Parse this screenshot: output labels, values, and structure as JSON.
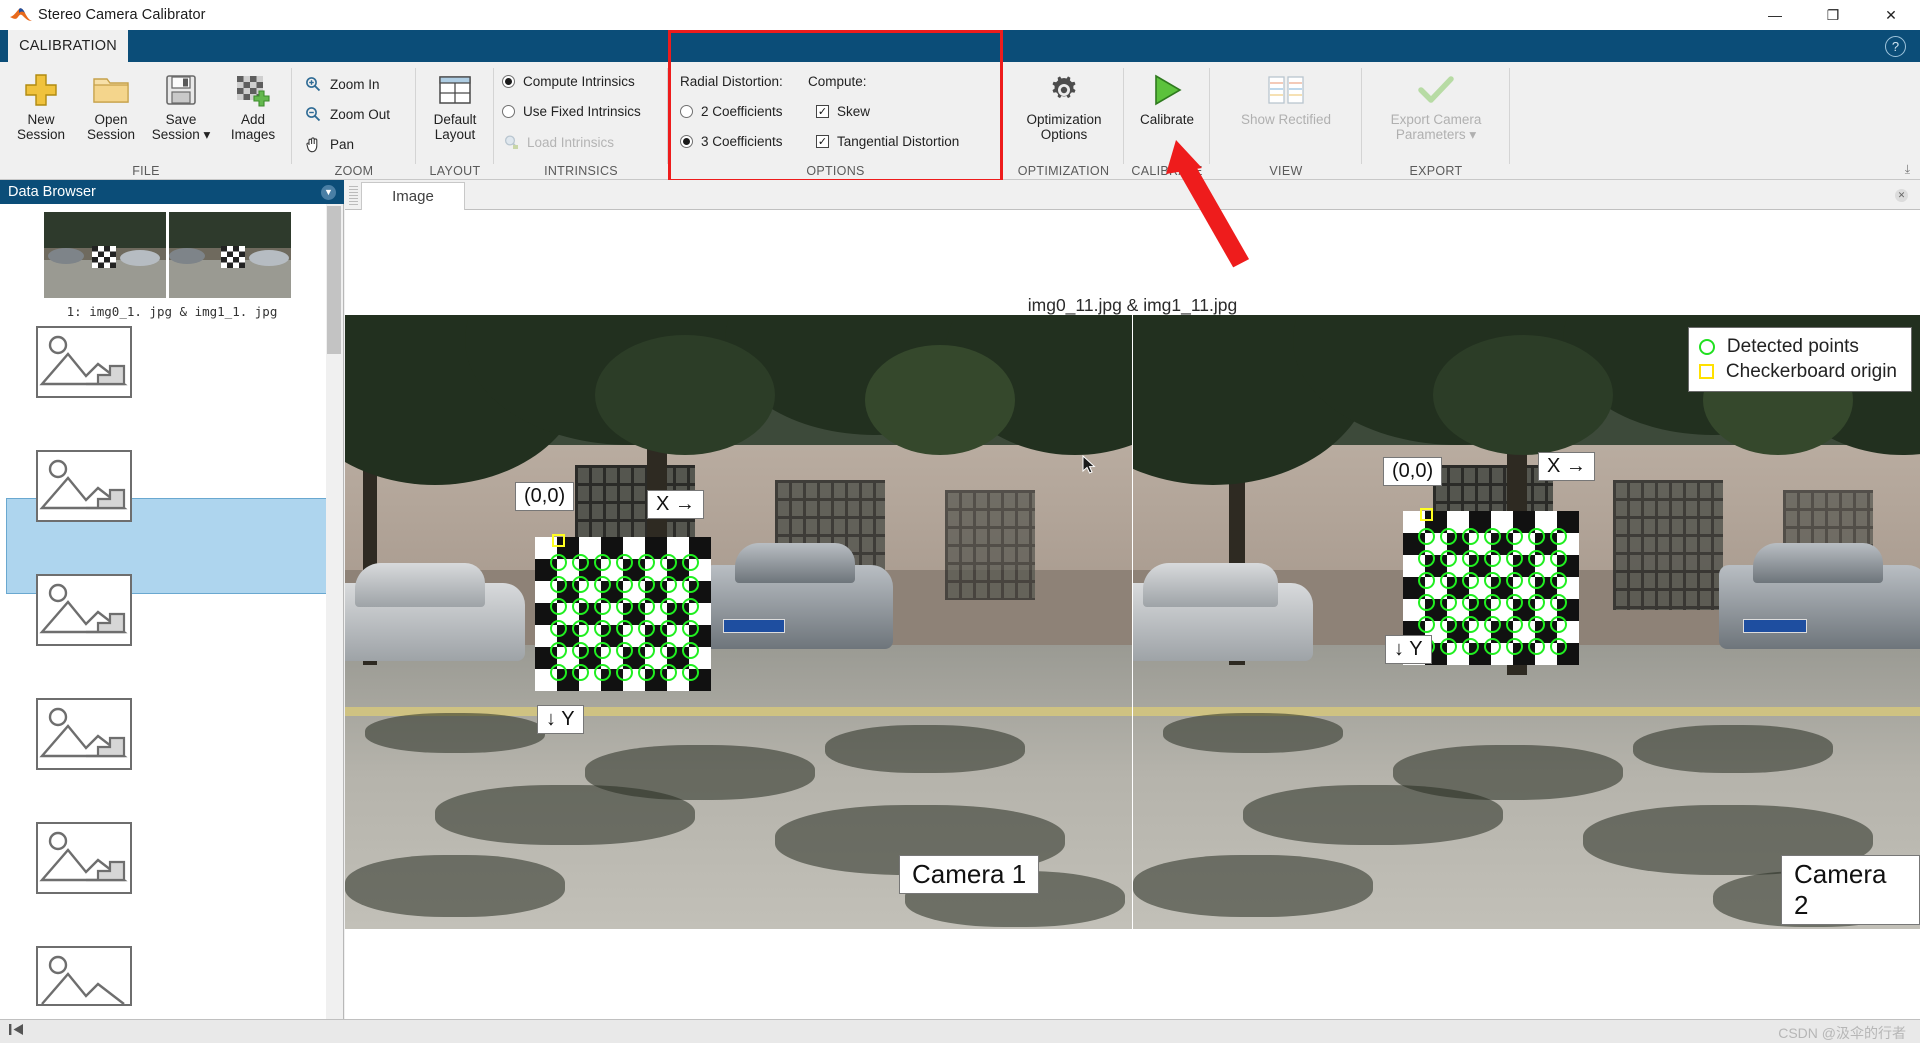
{
  "window": {
    "title": "Stereo Camera Calibrator",
    "logo_icon": "matlab-logo-icon",
    "minimize": "—",
    "maximize": "❐",
    "close": "✕"
  },
  "ribbon": {
    "tab": "CALIBRATION",
    "help_icon": "?",
    "collapse_icon": "⤓",
    "groups": [
      {
        "label": "FILE",
        "buttons": [
          {
            "label_line1": "New",
            "label_line2": "Session",
            "icon": "plus-icon",
            "enabled": true
          },
          {
            "label_line1": "Open",
            "label_line2": "Session",
            "icon": "folder-icon",
            "enabled": true
          },
          {
            "label_line1": "Save",
            "label_line2": "Session ▾",
            "icon": "save-disk-icon",
            "enabled": true
          },
          {
            "label_line1": "Add",
            "label_line2": "Images",
            "icon": "add-images-icon",
            "enabled": true
          }
        ]
      },
      {
        "label": "ZOOM",
        "items": [
          {
            "label": "Zoom In",
            "icon": "zoom-in-icon",
            "enabled": true
          },
          {
            "label": "Zoom Out",
            "icon": "zoom-out-icon",
            "enabled": true
          },
          {
            "label": "Pan",
            "icon": "hand-pan-icon",
            "enabled": true
          }
        ]
      },
      {
        "label": "LAYOUT",
        "buttons": [
          {
            "label_line1": "Default",
            "label_line2": "Layout",
            "icon": "layout-grid-icon",
            "enabled": true
          }
        ]
      },
      {
        "label": "INTRINSICS",
        "items": [
          {
            "label": "Compute Intrinsics",
            "control": "radio",
            "selected": true,
            "enabled": true
          },
          {
            "label": "Use Fixed Intrinsics",
            "control": "radio",
            "selected": false,
            "enabled": true
          },
          {
            "label": "Load Intrinsics",
            "control": "icon",
            "icon": "load-intrinsics-icon",
            "enabled": false
          }
        ]
      },
      {
        "label": "OPTIONS",
        "headers": {
          "radial": "Radial Distortion:",
          "compute": "Compute:"
        },
        "radial_options": [
          {
            "label": "2 Coefficients",
            "selected": false
          },
          {
            "label": "3 Coefficients",
            "selected": true
          }
        ],
        "compute_options": [
          {
            "label": "Skew",
            "checked": true
          },
          {
            "label": "Tangential Distortion",
            "checked": true
          }
        ],
        "highlight_color": "#ee1c1c"
      },
      {
        "label": "OPTIMIZATION",
        "buttons": [
          {
            "label_line1": "Optimization",
            "label_line2": "Options",
            "icon": "gear-icon",
            "enabled": true
          }
        ]
      },
      {
        "label": "CALIBRATE",
        "buttons": [
          {
            "label_line1": "Calibrate",
            "label_line2": "",
            "icon": "play-triangle-icon",
            "enabled": true
          }
        ]
      },
      {
        "label": "VIEW",
        "buttons": [
          {
            "label_line1": "Show Rectified",
            "label_line2": "",
            "icon": "rectified-pair-icon",
            "enabled": false
          }
        ]
      },
      {
        "label": "EXPORT",
        "buttons": [
          {
            "label_line1": "Export Camera",
            "label_line2": "Parameters ▾",
            "icon": "green-check-icon",
            "enabled": false
          }
        ]
      }
    ]
  },
  "data_browser": {
    "title": "Data Browser",
    "collapse_icon": "chevron-down-icon",
    "first_item_caption": "1:  img0_1. jpg  &  img1_1. jpg",
    "items": [
      {
        "index": 1,
        "type": "thumbnail-pair",
        "selected": false
      },
      {
        "index": 2,
        "type": "placeholder",
        "selected": false
      },
      {
        "index": 3,
        "type": "placeholder",
        "selected": true
      },
      {
        "index": 4,
        "type": "placeholder",
        "selected": false
      },
      {
        "index": 5,
        "type": "placeholder",
        "selected": false
      },
      {
        "index": 6,
        "type": "placeholder",
        "selected": false
      },
      {
        "index": 7,
        "type": "placeholder",
        "selected": false
      }
    ]
  },
  "image_panel": {
    "tab_label": "Image",
    "tab_close_icon": "close-icon",
    "panel_close_icon": "close-icon",
    "title": "img0_11.jpg & img1_11.jpg",
    "legend": [
      {
        "marker": "circle",
        "color": "#20e020",
        "label": "Detected points"
      },
      {
        "marker": "square",
        "color": "#ffe000",
        "label": "Checkerboard origin"
      }
    ],
    "left_photo": {
      "camera_label": "Camera 1",
      "origin_label": "(0,0)",
      "x_axis_label": "X →",
      "y_axis_label": "↓ Y"
    },
    "right_photo": {
      "camera_label": "Camera 2",
      "origin_label": "(0,0)",
      "x_axis_label": "X →",
      "y_axis_label": "↓ Y"
    }
  },
  "status_bar": {
    "left_icon": "skip-to-start-icon",
    "watermark": "CSDN @汲伞的行者"
  }
}
